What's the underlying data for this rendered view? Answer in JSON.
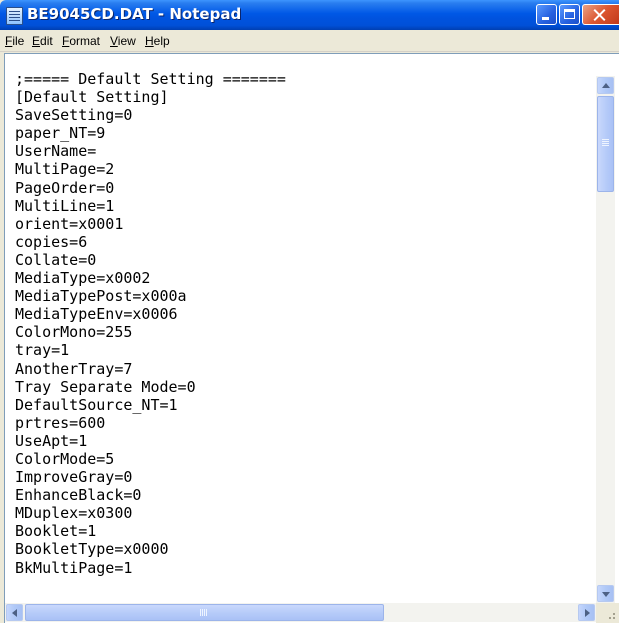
{
  "window": {
    "title": "BE9045CD.DAT - Notepad",
    "icon": "notepad-icon",
    "titlebar_color": "#0058E6",
    "close_color": "#DC5630"
  },
  "menu": {
    "items": [
      {
        "label": "File"
      },
      {
        "label": "Edit"
      },
      {
        "label": "Format"
      },
      {
        "label": "View"
      },
      {
        "label": "Help"
      }
    ]
  },
  "editor": {
    "lines": [
      ";===== Default Setting =======",
      "[Default Setting]",
      "SaveSetting=0",
      "paper_NT=9",
      "UserName=",
      "MultiPage=2",
      "PageOrder=0",
      "MultiLine=1",
      "orient=x0001",
      "copies=6",
      "Collate=0",
      "MediaType=x0002",
      "MediaTypePost=x000a",
      "MediaTypeEnv=x0006",
      "ColorMono=255",
      "tray=1",
      "AnotherTray=7",
      "Tray Separate Mode=0",
      "DefaultSource_NT=1",
      "prtres=600",
      "UseApt=1",
      "ColorMode=5",
      "ImproveGray=0",
      "EnhanceBlack=0",
      "MDuplex=x0300",
      "Booklet=1",
      "BookletType=x0000",
      "BkMultiPage=1"
    ]
  }
}
